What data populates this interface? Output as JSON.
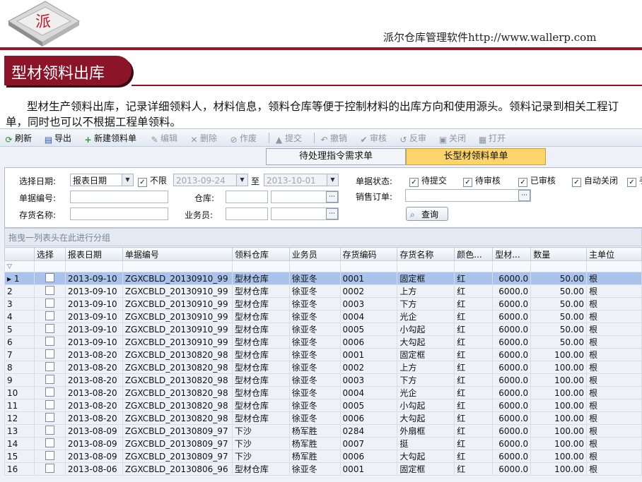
{
  "header": {
    "logo_text": "派",
    "site_text": "派尔仓库管理软件http://www.wallerp.com",
    "page_title": "型材领料出库",
    "intro": "型材生产领料出库，记录详细领料人，材料信息，领料仓库等便于控制材料的出库方向和使用源头。领料记录到相关工程订单，同时也可以不根据工程单领料。"
  },
  "toolbar": {
    "refresh": "刷新",
    "export": "导出",
    "new": "新建领料单",
    "edit": "编辑",
    "delete": "删除",
    "void": "作废",
    "submit": "提交",
    "withdraw": "撤销",
    "audit": "审核",
    "unaudit": "反审",
    "close": "关闭",
    "print": "打开"
  },
  "tabs": {
    "pending": "待处理指令需求单",
    "active": "长型材领料单单"
  },
  "filter": {
    "date_label": "选择日期:",
    "date_type": "报表日期",
    "unlimited": "不限",
    "date_from": "2013-09-24",
    "to": "至",
    "date_to": "2013-10-01",
    "status_label": "单据状态:",
    "statuses": [
      "待提交",
      "待审核",
      "已审核",
      "自动关闭",
      "手"
    ],
    "billno_label": "单据编号:",
    "warehouse_label": "仓库:",
    "sales_order_label": "销售订单:",
    "stock_name_label": "存货名称:",
    "staff_label": "业务员:",
    "query": "查询",
    "group_hint": "拖曳一列表头在此进行分组"
  },
  "grid": {
    "columns": [
      "",
      "选择",
      "报表日期",
      "单据编号",
      "领料仓库",
      "业务员",
      "存货编码",
      "存货名称",
      "颜色...",
      "型材...",
      "数量",
      "主单位"
    ],
    "rows": [
      [
        "1",
        "2013-09-10",
        "ZGXCBLD_20130910_99",
        "型材仓库",
        "徐亚冬",
        "0001",
        "固定框",
        "红",
        "6000.0",
        "50.00",
        "根"
      ],
      [
        "2",
        "2013-09-10",
        "ZGXCBLD_20130910_99",
        "型材仓库",
        "徐亚冬",
        "0002",
        "上方",
        "红",
        "6000.0",
        "50.00",
        "根"
      ],
      [
        "3",
        "2013-09-10",
        "ZGXCBLD_20130910_99",
        "型材仓库",
        "徐亚冬",
        "0003",
        "下方",
        "红",
        "6000.0",
        "50.00",
        "根"
      ],
      [
        "4",
        "2013-09-10",
        "ZGXCBLD_20130910_99",
        "型材仓库",
        "徐亚冬",
        "0004",
        "光企",
        "红",
        "6000.0",
        "50.00",
        "根"
      ],
      [
        "5",
        "2013-09-10",
        "ZGXCBLD_20130910_99",
        "型材仓库",
        "徐亚冬",
        "0005",
        "小勾起",
        "红",
        "6000.0",
        "50.00",
        "根"
      ],
      [
        "6",
        "2013-09-10",
        "ZGXCBLD_20130910_99",
        "型材仓库",
        "徐亚冬",
        "0006",
        "大勾起",
        "红",
        "6000.0",
        "50.00",
        "根"
      ],
      [
        "7",
        "2013-08-20",
        "ZGXCBLD_20130820_98",
        "型材仓库",
        "徐亚冬",
        "0001",
        "固定框",
        "红",
        "6000.0",
        "100.00",
        "根"
      ],
      [
        "8",
        "2013-08-20",
        "ZGXCBLD_20130820_98",
        "型材仓库",
        "徐亚冬",
        "0002",
        "上方",
        "红",
        "6000.0",
        "100.00",
        "根"
      ],
      [
        "9",
        "2013-08-20",
        "ZGXCBLD_20130820_98",
        "型材仓库",
        "徐亚冬",
        "0003",
        "下方",
        "红",
        "6000.0",
        "100.00",
        "根"
      ],
      [
        "10",
        "2013-08-20",
        "ZGXCBLD_20130820_98",
        "型材仓库",
        "徐亚冬",
        "0004",
        "光企",
        "红",
        "6000.0",
        "100.00",
        "根"
      ],
      [
        "11",
        "2013-08-20",
        "ZGXCBLD_20130820_98",
        "型材仓库",
        "徐亚冬",
        "0005",
        "小勾起",
        "红",
        "6000.0",
        "100.00",
        "根"
      ],
      [
        "12",
        "2013-08-20",
        "ZGXCBLD_20130820_98",
        "型材仓库",
        "徐亚冬",
        "0006",
        "大勾起",
        "红",
        "6000.0",
        "100.00",
        "根"
      ],
      [
        "13",
        "2013-08-09",
        "ZGXCBLD_20130809_97",
        "下沙",
        "杨军胜",
        "0284",
        "外扇框",
        "红",
        "6000.0",
        "100.00",
        "根"
      ],
      [
        "14",
        "2013-08-09",
        "ZGXCBLD_20130809_97",
        "下沙",
        "杨军胜",
        "0007",
        "挺",
        "红",
        "6000.0",
        "100.00",
        "根"
      ],
      [
        "15",
        "2013-08-09",
        "ZGXCBLD_20130809_97",
        "下沙",
        "杨军胜",
        "0006",
        "大勾起",
        "红",
        "6000.0",
        "100.00",
        "根"
      ],
      [
        "16",
        "2013-08-06",
        "ZGXCBLD_20130806_96",
        "型材仓库",
        "徐亚冬",
        "0001",
        "固定框",
        "红",
        "6000.0",
        "100.00",
        "根"
      ]
    ]
  },
  "colors": {
    "brand_red": "#8c1428",
    "selected_row": "#a9c3ec",
    "active_tab": "#fbd46a"
  }
}
